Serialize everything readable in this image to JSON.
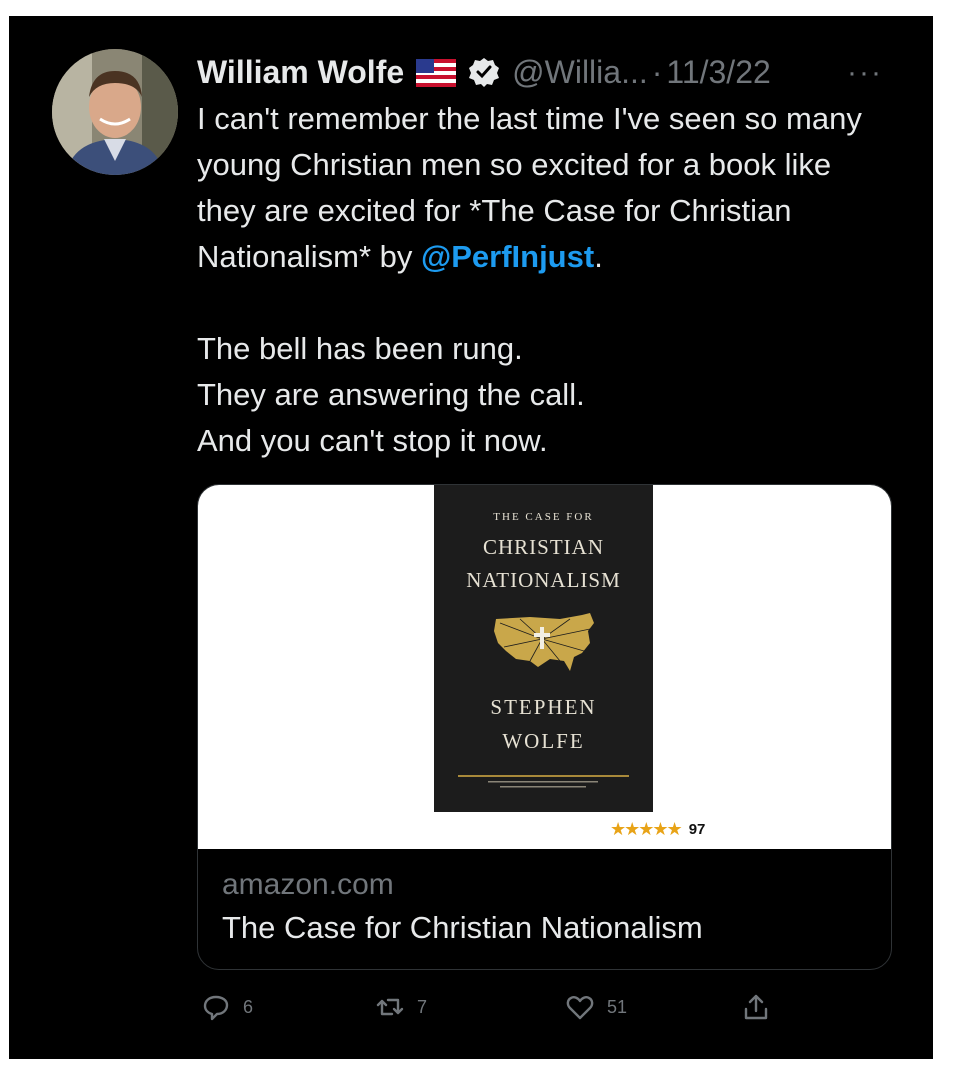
{
  "tweet": {
    "author": {
      "name": "William Wolfe",
      "handle": "@Willia...",
      "avatar_icon": "user-avatar-photo",
      "flag_icon": "us-flag-icon",
      "verified_icon": "verified-badge-icon"
    },
    "separator": "·",
    "date": "11/3/22",
    "more_icon": "more-options-icon",
    "body": {
      "line1_part1": "I can't remember the last time I've seen so many young Christian men so excited for a book like they are excited for *The Case for Christian Nationalism* by ",
      "mention": "@PerfInjust",
      "line1_end": ".",
      "line2": "The bell has been rung.",
      "line3": "They are answering the call.",
      "line4": "And you can't stop it now."
    },
    "card": {
      "book_cover": {
        "kicker": "THE CASE FOR",
        "title_line1": "CHRISTIAN",
        "title_line2": "NATIONALISM",
        "author_line1": "STEPHEN",
        "author_line2": "WOLFE",
        "map_icon": "usa-map-cross-icon"
      },
      "rating_stars": "★★★★★",
      "rating_count": "97",
      "domain": "amazon.com",
      "title": "The Case for Christian Nationalism"
    },
    "actions": {
      "reply_count": "6",
      "retweet_count": "7",
      "like_count": "51"
    },
    "colors": {
      "background": "#000000",
      "text": "#e7e9ea",
      "secondary": "#71767b",
      "link": "#1d9bf0",
      "star": "#e8a317"
    }
  }
}
